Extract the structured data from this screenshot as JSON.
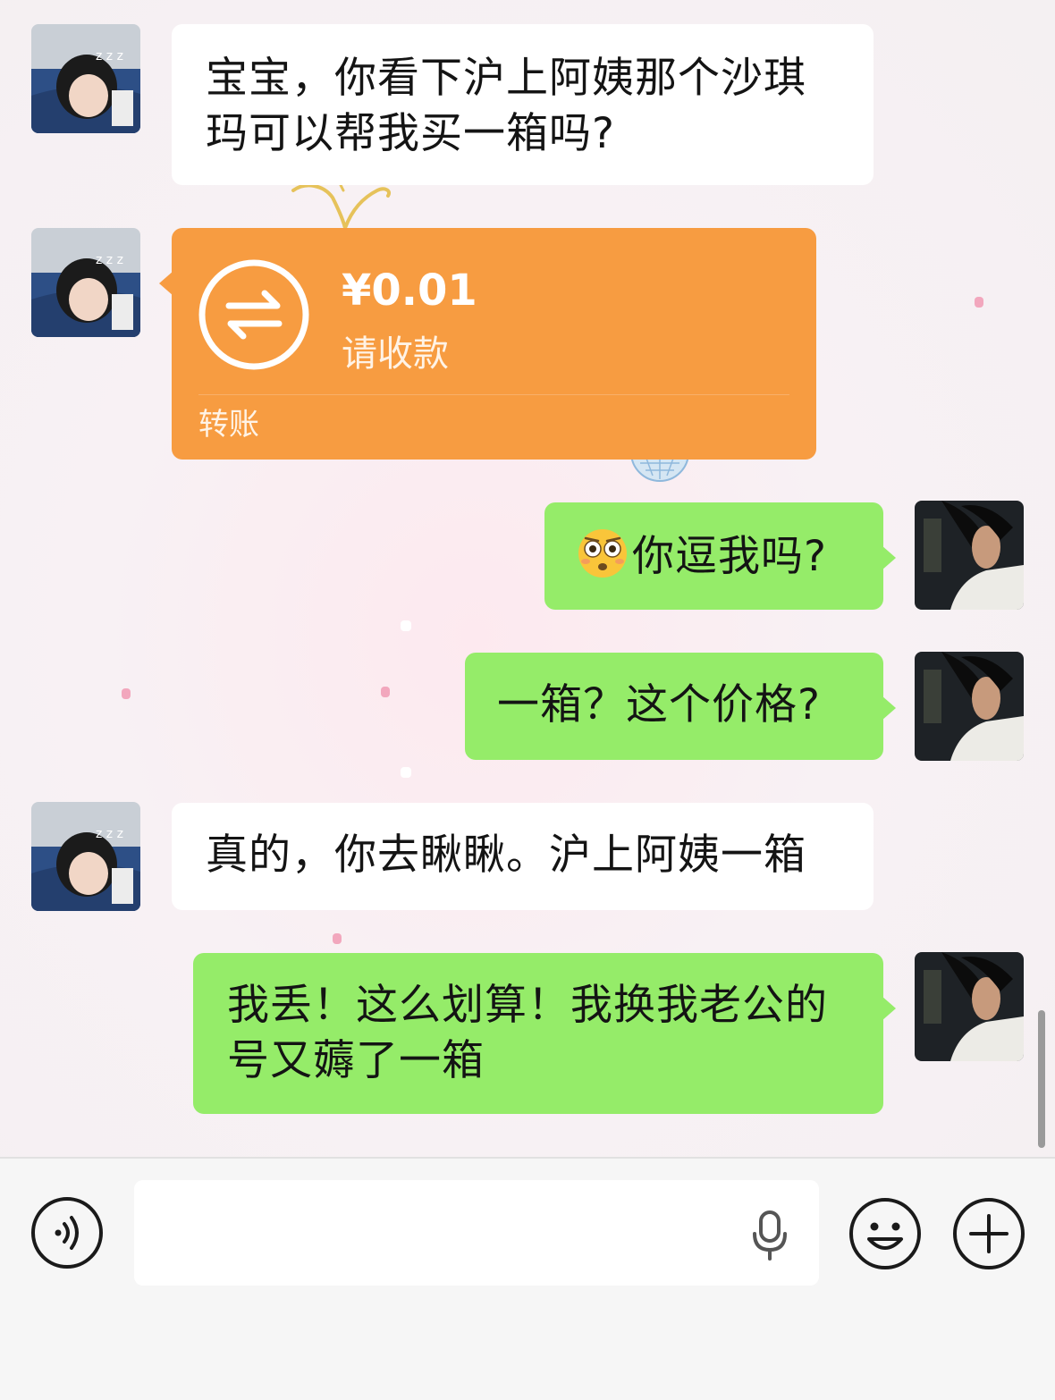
{
  "colors": {
    "incoming_bubble": "#ffffff",
    "outgoing_bubble": "#95ec69",
    "transfer_card": "#f79c41",
    "input_bar": "#f6f6f6"
  },
  "messages": [
    {
      "sender": "contact",
      "type": "text",
      "text": "宝宝，你看下沪上阿姨那个沙琪玛可以帮我买一箱吗?"
    },
    {
      "sender": "contact",
      "type": "transfer",
      "amount": "¥0.01",
      "subtitle": "请收款",
      "label": "转账",
      "icon": "transfer-arrows-icon"
    },
    {
      "sender": "me",
      "type": "text",
      "emoji": "flushed-face-emoji",
      "text": "你逗我吗?"
    },
    {
      "sender": "me",
      "type": "text",
      "text": "一箱？这个价格?"
    },
    {
      "sender": "contact",
      "type": "text",
      "text": "真的，你去瞅瞅。沪上阿姨一箱"
    },
    {
      "sender": "me",
      "type": "text",
      "text": "我丢！这么划算！我换我老公的号又薅了一箱"
    }
  ],
  "input_bar": {
    "voice_icon": "voice-mode-icon",
    "input_value": "",
    "mic_icon": "microphone-icon",
    "emoji_icon": "emoji-icon",
    "more_icon": "plus-icon"
  }
}
